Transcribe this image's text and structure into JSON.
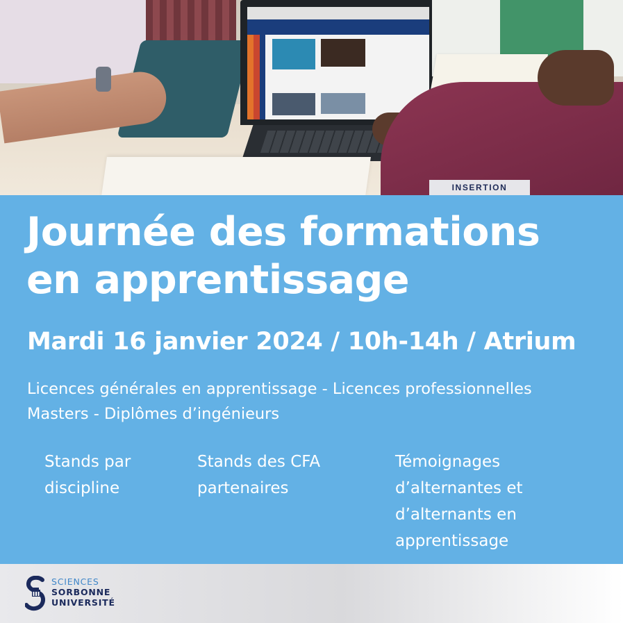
{
  "tag": {
    "label": "INSERTION"
  },
  "event": {
    "title_lines": [
      "Journée des formations",
      "en apprentissage"
    ],
    "details": "Mardi 16 janvier 2024 / 10h-14h / Atrium",
    "programs": [
      "Licences générales en apprentissage - Licences professionnelles",
      "Masters - Diplômes d’ingénieurs"
    ],
    "features": [
      {
        "lines": [
          "Stands par",
          "discipline"
        ]
      },
      {
        "lines": [
          "Stands des CFA",
          "partenaires"
        ]
      },
      {
        "lines": [
          "Témoignages",
          "d’alternantes et",
          "d’alternants en",
          "apprentissage"
        ]
      }
    ]
  },
  "logo": {
    "lines": [
      "SCIENCES",
      "SORBONNE",
      "UNIVERSITÉ"
    ]
  },
  "colors": {
    "panel": "#63b1e5",
    "tag_text": "#1e2b57",
    "logo_navy": "#1b2a5c",
    "logo_blue": "#3f86c8"
  }
}
